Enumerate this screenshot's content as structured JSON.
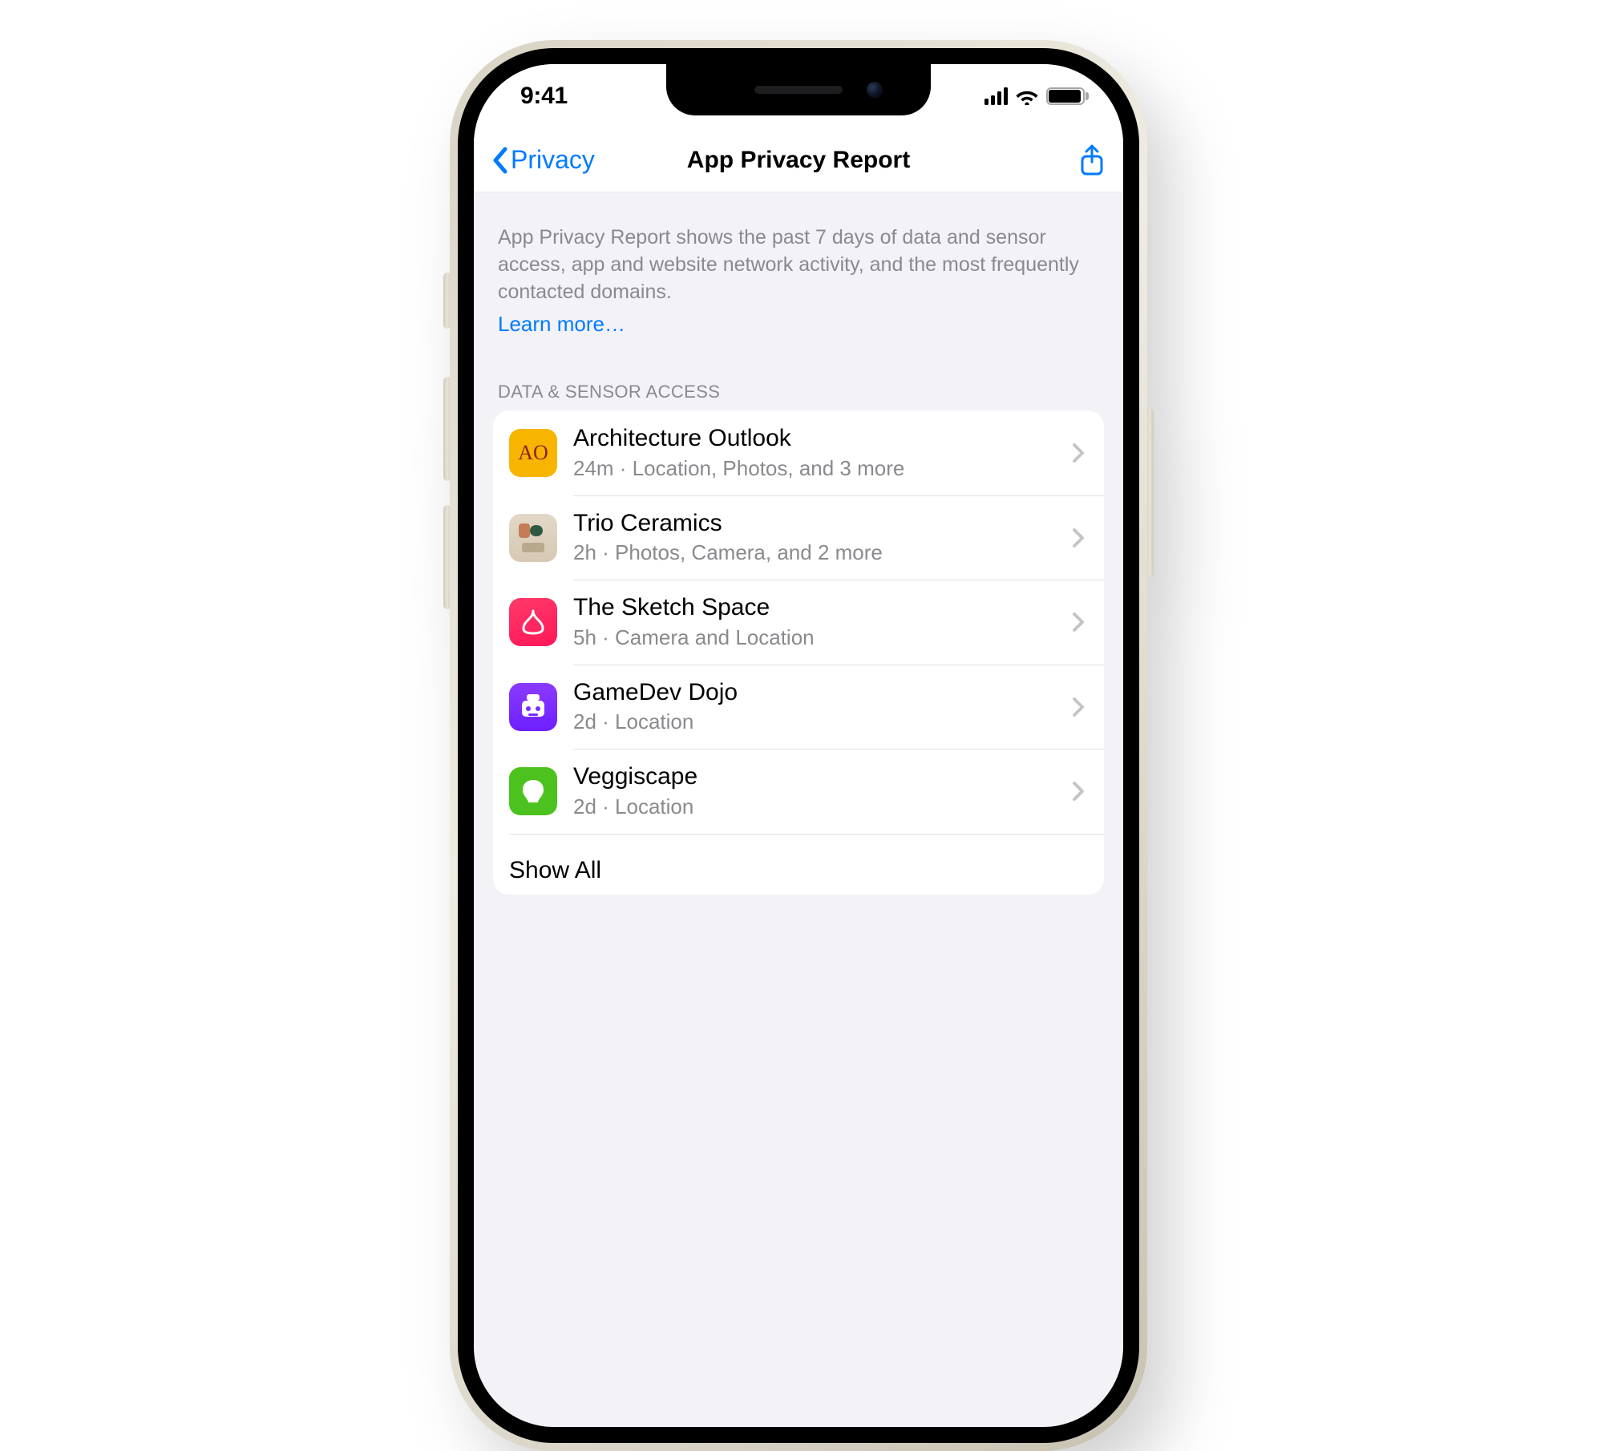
{
  "status": {
    "time": "9:41"
  },
  "nav": {
    "back_label": "Privacy",
    "title": "App Privacy Report"
  },
  "intro": {
    "text": "App Privacy Report shows the past 7 days of data and sensor access, app and website network activity, and the most frequently contacted domains.",
    "learn_more": "Learn more…"
  },
  "section": {
    "header": "DATA & SENSOR ACCESS",
    "rows": [
      {
        "title": "Architecture Outlook",
        "subtitle": "24m · Location, Photos, and 3 more",
        "icon": "ao"
      },
      {
        "title": "Trio Ceramics",
        "subtitle": "2h · Photos, Camera, and 2 more",
        "icon": "trio"
      },
      {
        "title": "The Sketch Space",
        "subtitle": "5h · Camera and Location",
        "icon": "sketch"
      },
      {
        "title": "GameDev Dojo",
        "subtitle": "2d · Location",
        "icon": "dojo"
      },
      {
        "title": "Veggiscape",
        "subtitle": "2d · Location",
        "icon": "veg"
      }
    ],
    "show_all": "Show All"
  }
}
